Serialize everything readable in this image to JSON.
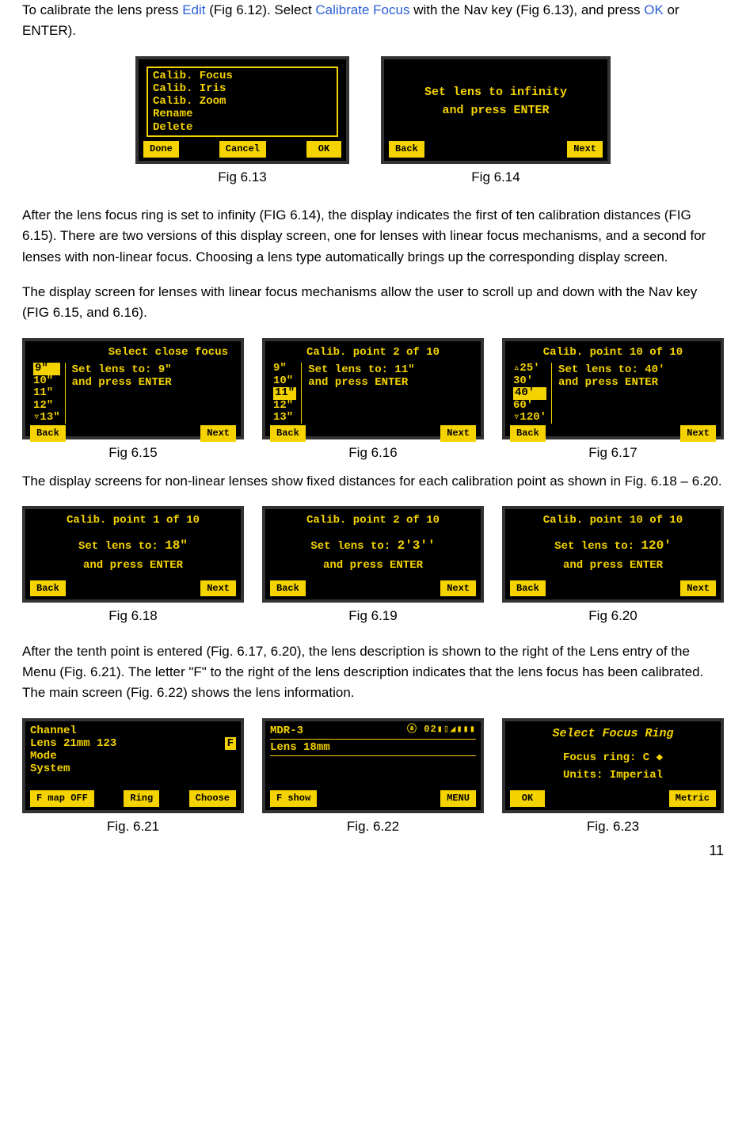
{
  "intro": {
    "p1_a": "To calibrate the lens press ",
    "edit": "Edit",
    "p1_b": " (Fig 6.12).  Select ",
    "calfocus": "Calibrate Focus",
    "p1_c": " with the Nav key (Fig 6.13), and press ",
    "ok": "OK",
    "p1_d": " or ENTER)."
  },
  "fig613": {
    "menu": [
      "Calib. Focus",
      "Calib. Iris",
      "Calib. Zoom",
      "Rename",
      "Delete"
    ],
    "btnDone": "Done",
    "btnCancel": "Cancel",
    "btnOK": "OK",
    "caption": "Fig 6.13"
  },
  "fig614": {
    "line1": "Set lens to infinity",
    "line2": "and press ENTER",
    "btnBack": "Back",
    "btnNext": "Next",
    "caption": "Fig 6.14"
  },
  "para2": "After the lens focus ring is set to infinity (FIG 6.14), the display indicates the first of ten calibration distances (FIG 6.15). There are two versions of this display screen, one for lenses with linear focus mechanisms, and a second for lenses with non-linear focus. Choosing a lens type automatically brings up the corresponding display screen.",
  "para3": "The display screen for lenses with linear focus mechanisms allow the user to scroll up and down with the Nav key (FIG 6.15, and 6.16).",
  "fig615": {
    "title": "Select close focus",
    "list": [
      "9\"",
      "10\"",
      "11\"",
      "12\"",
      "▿13\""
    ],
    "sel": "9\"",
    "msg1": "Set lens to: 9\"",
    "msg2": "and press ENTER",
    "btnBack": "Back",
    "btnNext": "Next",
    "caption": "Fig 6.15"
  },
  "fig616": {
    "title": "Calib. point 2  of 10",
    "list": [
      "9\"",
      "10\"",
      "11\"",
      "12\"",
      "13\""
    ],
    "sel": "11\"",
    "msg1": "Set lens to: 11\"",
    "msg2": "and press ENTER",
    "btnBack": "Back",
    "btnNext": "Next",
    "caption": "Fig 6.16"
  },
  "fig617": {
    "title": "Calib. point 10 of 10",
    "list": [
      "▵25'",
      "30'",
      "40'",
      "60'",
      "▿120'"
    ],
    "sel": "40'",
    "msg1": "Set lens to: 40'",
    "msg2": "and press ENTER",
    "btnBack": "Back",
    "btnNext": "Next",
    "caption": "Fig 6.17"
  },
  "para4": "The display screens for non-linear lenses show fixed distances for each calibration point as shown in Fig. 6.18 – 6.20.",
  "fig618": {
    "title": "Calib. point 1  of 10",
    "line1a": "Set lens to:   ",
    "line1b": "18\"",
    "line2": "and press ENTER",
    "btnBack": "Back",
    "btnNext": "Next",
    "caption": "Fig 6.18"
  },
  "fig619": {
    "title": "Calib. point 2  of 10",
    "line1a": "Set lens to:   ",
    "line1b": "2'3''",
    "line2": "and press ENTER",
    "btnBack": "Back",
    "btnNext": "Next",
    "caption": "Fig 6.19"
  },
  "fig620": {
    "title": "Calib. point 10 of 10",
    "line1a": "Set lens to:   ",
    "line1b": "120'",
    "line2": "and press ENTER",
    "btnBack": "Back",
    "btnNext": "Next",
    "caption": "Fig 6.20"
  },
  "para5": "After the tenth point is entered (Fig. 6.17, 6.20), the lens description is shown to the right of the Lens entry of the Menu (Fig. 6.21). The letter \"F\" to the right of the lens description indicates that the lens focus has been calibrated.  The main screen (Fig. 6.22) shows the lens information.",
  "fig621": {
    "l1": "Channel",
    "l2": "Lens   21mm 123            ",
    "l2f": "F",
    "l3": "Mode",
    "l4": "System",
    "btn1": "F map OFF",
    "btn2": "Ring",
    "btn3": "Choose",
    "caption": "Fig. 6.21"
  },
  "fig622": {
    "top1": "MDR-3",
    "top2": "ⓐ   02▮▯◢▮▮▮",
    "line": "Lens  18mm",
    "btn1": "F show",
    "btn2": "MENU",
    "caption": "Fig. 6.22"
  },
  "fig623": {
    "title": "Select Focus Ring",
    "l1": "Focus ring:  C ◆",
    "l2": "Units: Imperial",
    "btn1": "OK",
    "btn2": "Metric",
    "caption": "Fig. 6.23"
  },
  "pageNum": "11"
}
